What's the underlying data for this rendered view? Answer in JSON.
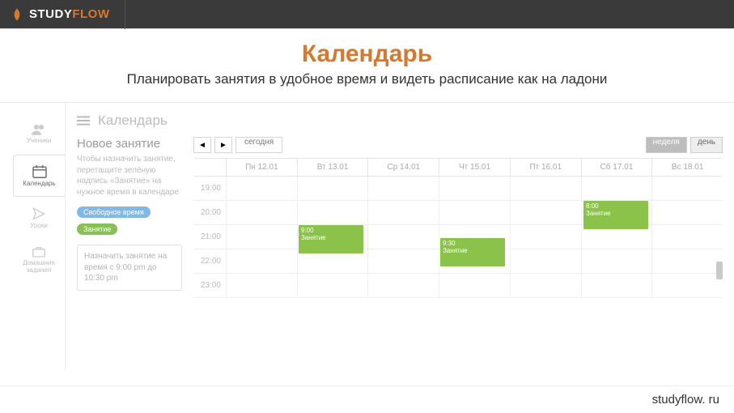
{
  "brand": {
    "study": "STUDY",
    "flow": "FLOW"
  },
  "hero": {
    "title": "Календарь",
    "subtitle": "Планировать занятия в удобное время и видеть расписание как на ладони"
  },
  "sidebar": {
    "items": [
      {
        "label": "Ученики"
      },
      {
        "label": "Календарь"
      },
      {
        "label": "Уроки"
      },
      {
        "label": "Домашние задания"
      }
    ]
  },
  "content": {
    "title": "Календарь"
  },
  "new_event": {
    "title": "Новое занятие",
    "desc": "Чтобы назначить занятие, перетащите зелёную надпись «Занятие» на нужное время в календаре",
    "pill_free": "Свободное время",
    "pill_event": "Занятие"
  },
  "hint": "Назначить занятие на время с 9:00 pm до 10:30 pm",
  "cal": {
    "today": "сегодня",
    "view_week": "неделя",
    "view_day": "день",
    "days": [
      "Пн 12.01",
      "Вт 13.01",
      "Ср 14.01",
      "Чт 15.01",
      "Пт 16.01",
      "Сб 17.01",
      "Вс 18.01"
    ],
    "hours": [
      "19:00",
      "20:00",
      "21:00",
      "22:00",
      "23:00"
    ]
  },
  "events": [
    {
      "time": "9:00",
      "label": "Занятие"
    },
    {
      "time": "9:30",
      "label": "Занятие"
    },
    {
      "time": "8:00",
      "label": "Занятие"
    }
  ],
  "footer": "studyflow. ru"
}
